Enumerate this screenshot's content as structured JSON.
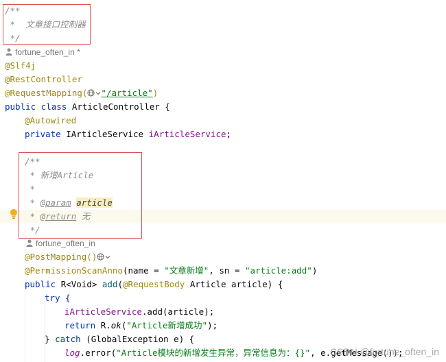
{
  "class_doc": {
    "open": "/**",
    "desc": " *  文章接口控制器",
    "close": " */"
  },
  "class_author": "fortune_often_in *",
  "class_annotations": {
    "slf4j": "@Slf4j",
    "rest_controller": "@RestController",
    "request_mapping": "@RequestMapping(",
    "request_mapping_path": "\"/article\"",
    "request_mapping_close": ")"
  },
  "class_decl": {
    "modifiers": "public class ",
    "name": "ArticleController",
    "brace": " {"
  },
  "field": {
    "annotation": "@Autowired",
    "modifier": "private ",
    "type": "IArticleService ",
    "name": "iArticleService",
    "semicolon": ";"
  },
  "method_doc": {
    "open": "/**",
    "desc_prefix": " * 新增Article",
    "blank": " *",
    "param_prefix": " * ",
    "param_tag": "@param",
    "param_name": "article",
    "return_prefix": " * ",
    "return_tag": "@return",
    "return_desc": " 无",
    "close": " */"
  },
  "method_author": "fortune_often_in",
  "method_annotations": {
    "post_mapping": "@PostMapping()",
    "perm_name": "@PermissionScanAnno",
    "perm_open": "(name = ",
    "perm_name_value": "\"文章新增\"",
    "perm_sep": ", sn = ",
    "perm_sn_value": "\"article:add\"",
    "perm_close": ")"
  },
  "method_decl": {
    "modifier": "public ",
    "return_type": "R<Void> ",
    "name": "add",
    "open": "(",
    "param_annotation": "@RequestBody",
    "param": " Article article) {"
  },
  "body": {
    "try": "try {",
    "call_field": "iArticleService",
    "call_rest": ".add(article);",
    "return_kw": "return ",
    "return_call": "R.",
    "return_method": "ok",
    "return_open": "(",
    "return_str": "\"Article新增成功\"",
    "return_close": ");",
    "catch_prefix": "} ",
    "catch_kw": "catch",
    "catch_rest": " (GlobalException e) {",
    "log_field": "log",
    "log_rest": ".error(",
    "log_str": "\"Article模块的新增发生异常，异常信息为：{}\"",
    "log_tail": ", e.getMessage());"
  },
  "watermark": "CSDN @fortune_often_in",
  "colors": {
    "keyword": "#0033b3",
    "annotation": "#9e880d",
    "string": "#067d17",
    "comment": "#8c8c8c",
    "field": "#871094",
    "highlight_box": "#e05050"
  }
}
